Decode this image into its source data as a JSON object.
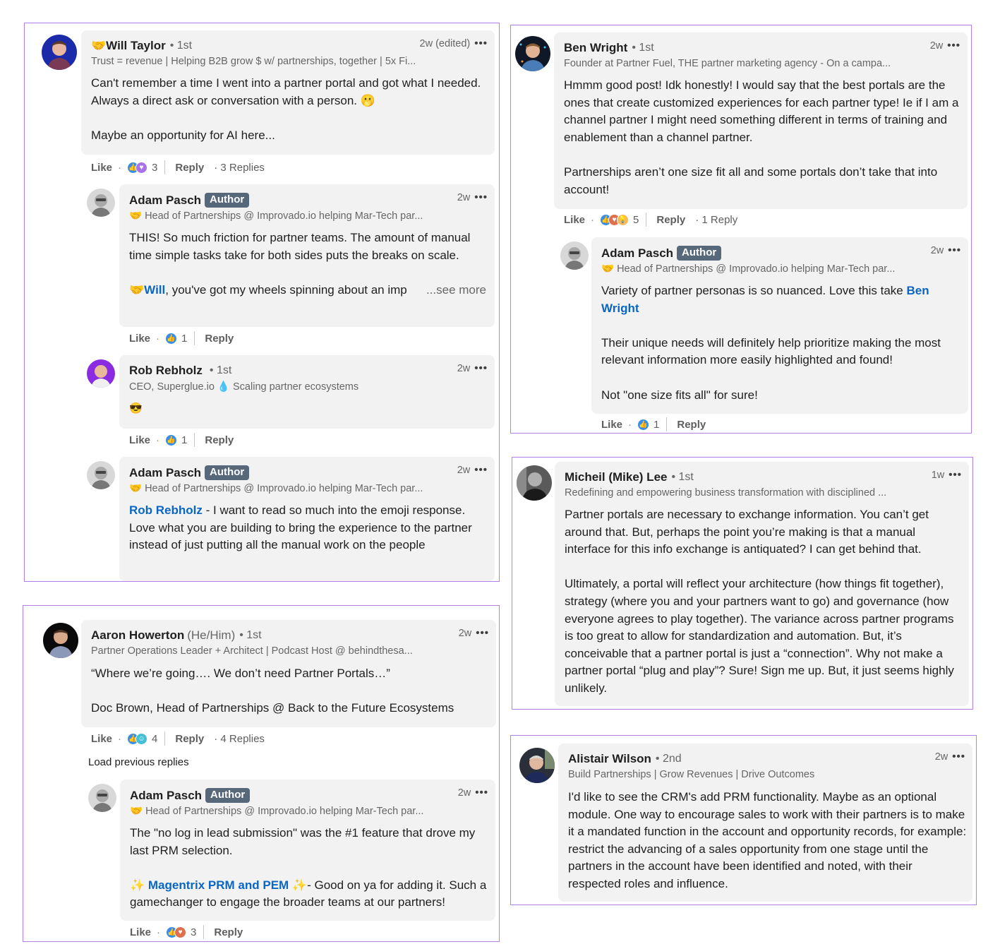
{
  "colors": {
    "frame": "#b57ee8",
    "bubble": "#f2f2f2",
    "mention": "#0a66c2",
    "author_badge": "#56687a",
    "like": "#378fe9",
    "love": "#df704d",
    "insight": "#f5bb5c",
    "support": "#a872e8",
    "funny": "#44bfd3"
  },
  "labels": {
    "like": "Like",
    "reply": "Reply",
    "more_icon": "•••",
    "dot": "·",
    "author": "Author",
    "load_previous": "Load previous replies",
    "see_more": "...see more"
  },
  "threads": [
    {
      "comments": [
        {
          "name_prefix_emoji": "🤝",
          "name": "Will Taylor",
          "degree": "• 1st",
          "headline": "Trust = revenue | Helping B2B grow $ w/ partnerships, together | 5x Fi...",
          "time": "2w (edited)",
          "body": [
            "Can't remember a time I went into a partner portal and got what I needed. Always a direct ask or conversation with a person. 🫢",
            "",
            "Maybe an opportunity for AI here..."
          ],
          "reactions": [
            "like",
            "support"
          ],
          "reaction_count": "3",
          "replies": "· 3 Replies"
        },
        {
          "name": "Adam Pasch",
          "is_author": true,
          "headline": "🤝 Head of Partnerships @ Improvado.io helping Mar-Tech par...",
          "time": "2w",
          "body": [
            "THIS! So much friction for partner teams. The amount of manual time simple tasks take for both sides puts the breaks on scale.",
            ""
          ],
          "body_mention_line": {
            "prefix": "🤝",
            "mention": "Will",
            "rest": ", you've got my wheels spinning about an imp"
          },
          "reactions": [
            "like"
          ],
          "reaction_count": "1"
        },
        {
          "name": "Rob Rebholz",
          "degree": "• 1st",
          "headline": "CEO, Superglue.io 💧 Scaling partner ecosystems",
          "time": "2w",
          "body": [
            "😎"
          ],
          "reactions": [
            "like"
          ],
          "reaction_count": "1"
        },
        {
          "name": "Adam Pasch",
          "is_author": true,
          "headline": "🤝 Head of Partnerships @ Improvado.io helping Mar-Tech par...",
          "time": "2w",
          "mention": "Rob Rebholz",
          "body_after_mention": " - I want to read so much into the emoji response. Love what you are building to bring the experience to the partner instead of just putting all the manual work on the people"
        }
      ]
    },
    {
      "comments": [
        {
          "name": "Aaron Howerton",
          "pronoun": "(He/Him)",
          "degree": "• 1st",
          "headline": "Partner Operations Leader + Architect | Podcast Host @ behindthesa...",
          "time": "2w",
          "body": [
            "“Where we’re going…. We don’t need Partner Portals…”",
            "",
            "Doc Brown, Head of Partnerships @ Back to the Future Ecosystems"
          ],
          "reactions": [
            "like",
            "funny"
          ],
          "reaction_count": "4",
          "replies": "· 4 Replies"
        },
        {
          "name": "Adam Pasch",
          "is_author": true,
          "headline": "🤝 Head of Partnerships @ Improvado.io helping Mar-Tech par...",
          "time": "2w",
          "body": [
            "The \"no log in lead submission\" was the #1 feature that drove my last PRM selection.",
            ""
          ],
          "mention_line": {
            "before": "✨ ",
            "mention": "Magentrix PRM and PEM",
            "after_emoji": " ✨",
            "rest": "- Good on ya for adding it. Such a gamechanger to engage the broader teams at our partners!"
          },
          "reactions": [
            "like",
            "love"
          ],
          "reaction_count": "3"
        }
      ]
    },
    {
      "comments": [
        {
          "name": "Ben Wright",
          "degree": "• 1st",
          "headline": "Founder at Partner Fuel, THE partner marketing agency - On a campa...",
          "time": "2w",
          "body": [
            "Hmmm good post! Idk honestly! I would say that the best portals are the ones that create customized experiences for each partner type! Ie if I am a channel partner I might need something different in terms of training and enablement than a channel partner.",
            "",
            "Partnerships aren’t one size fit all and some portals don’t take that into account!"
          ],
          "reactions": [
            "like",
            "love",
            "insight"
          ],
          "reaction_count": "5",
          "replies": "· 1 Reply"
        },
        {
          "name": "Adam Pasch",
          "is_author": true,
          "headline": "🤝 Head of Partnerships @ Improvado.io helping Mar-Tech par...",
          "time": "2w",
          "body_before_mention": "Variety of partner personas is so nuanced. Love this take ",
          "mention": "Ben Wright",
          "body": [
            "",
            "Their unique needs will definitely help prioritize making the most relevant information more easily highlighted and found!",
            "",
            "Not \"one size fits all\" for sure!"
          ],
          "reactions": [
            "like"
          ],
          "reaction_count": "1"
        }
      ]
    },
    {
      "comments": [
        {
          "name": "Micheil (Mike) Lee",
          "degree": "• 1st",
          "headline": "Redefining and empowering business transformation with disciplined ...",
          "time": "1w",
          "body": [
            "Partner portals are necessary to exchange information. You can’t get around that. But, perhaps the point you’re making is that a manual interface for this info exchange is antiquated? I can get behind that.",
            "",
            "Ultimately, a portal will reflect your architecture (how things fit together), strategy (where you and your partners want to go) and governance (how everyone agrees to play together). The variance across partner programs is too great to allow for standardization and automation. But, it’s conceivable that a partner portal is just a “connection”. Why not make a partner portal “plug and play”? Sure! Sign me up. But, it just seems highly unlikely."
          ]
        }
      ]
    },
    {
      "comments": [
        {
          "name": "Alistair Wilson",
          "degree": "• 2nd",
          "headline": "Build Partnerships | Grow Revenues | Drive Outcomes",
          "time": "2w",
          "body": [
            "I'd like to see the CRM's add PRM functionality. Maybe as an optional module. One way to encourage sales to work with their partners is to make it a mandated function in the account and opportunity records, for example: restrict the advancing of a sales opportunity from one stage until the partners in the account have been identified and noted, with their respected roles and influence."
          ]
        }
      ]
    }
  ]
}
